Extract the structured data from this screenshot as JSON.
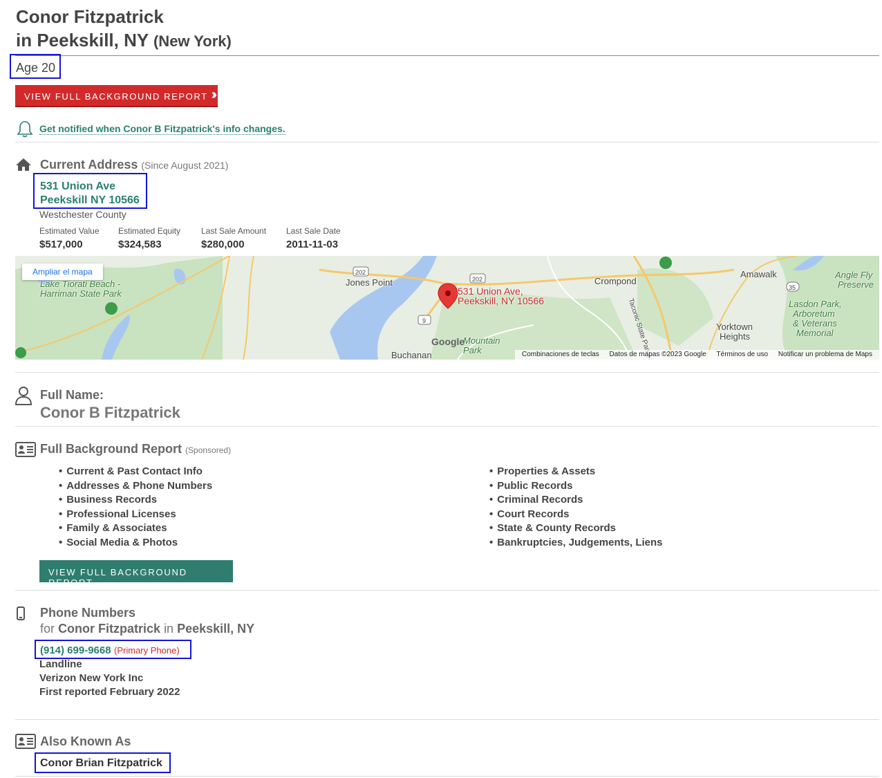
{
  "header": {
    "name": "Conor Fitzpatrick",
    "location_prefix": "in Peekskill, NY",
    "state": "(New York)",
    "age": "Age 20"
  },
  "buttons": {
    "red_report": "VIEW FULL BACKGROUND REPORT",
    "green_report": "VIEW FULL BACKGROUND REPORT"
  },
  "notify": {
    "text": "Get notified when Conor B Fitzpatrick's info changes."
  },
  "current_address": {
    "title": "Current Address",
    "since": "(Since August 2021)",
    "line1": "531 Union Ave",
    "line2": "Peekskill NY 10566",
    "county": "Westchester County",
    "stats": [
      {
        "label": "Estimated Value",
        "value": "$517,000"
      },
      {
        "label": "Estimated Equity",
        "value": "$324,583"
      },
      {
        "label": "Last Sale Amount",
        "value": "$280,000"
      },
      {
        "label": "Last Sale Date",
        "value": "2011-11-03"
      }
    ]
  },
  "map": {
    "enlarge": "Ampliar el mapa",
    "pin_line1": "531 Union Ave,",
    "pin_line2": "Peekskill, NY 10566",
    "places": {
      "lake_tiorati_1": "Lake Tiorati Beach -",
      "lake_tiorati_2": "Harriman State Park",
      "jones_point": "Jones Point",
      "crompond": "Crompond",
      "amawalk": "Amawalk",
      "angle_fly_1": "Angle Fly",
      "angle_fly_2": "Preserve",
      "lasdon_1": "Lasdon Park,",
      "lasdon_2": "Arboretum",
      "lasdon_3": "& Veterans",
      "lasdon_4": "Memorial",
      "yorktown_1": "Yorktown",
      "yorktown_2": "Heights",
      "buchanan": "Buchanan",
      "mountain_1": "Mountain",
      "mountain_2": "Park",
      "taconic": "Taconic State Parkway",
      "route_202a": "202",
      "route_202b": "202",
      "route_9": "9",
      "route_35": "35"
    },
    "logo": "Google",
    "attrib": [
      "Combinaciones de teclas",
      "Datos de mapas ©2023 Google",
      "Términos de uso",
      "Notificar un problema de Maps"
    ]
  },
  "full_name": {
    "label": "Full Name:",
    "value": "Conor B Fitzpatrick"
  },
  "report": {
    "title": "Full Background Report",
    "sponsored": "(Sponsored)",
    "left": [
      "Current & Past Contact Info",
      "Addresses & Phone Numbers",
      "Business Records",
      "Professional Licenses",
      "Family & Associates",
      "Social Media & Photos"
    ],
    "right": [
      "Properties & Assets",
      "Public Records",
      "Criminal Records",
      "Court Records",
      "State & County Records",
      "Bankruptcies, Judgements, Liens"
    ]
  },
  "phones": {
    "title": "Phone Numbers",
    "for_word": "for",
    "for_name": "Conor Fitzpatrick",
    "in_word": "in",
    "for_place": "Peekskill, NY",
    "number": "(914) 699-9668",
    "tag": "(Primary Phone)",
    "type": "Landline",
    "carrier": "Verizon New York Inc",
    "reported": "First reported February 2022"
  },
  "aka": {
    "title": "Also Known As",
    "value": "Conor Brian Fitzpatrick"
  }
}
